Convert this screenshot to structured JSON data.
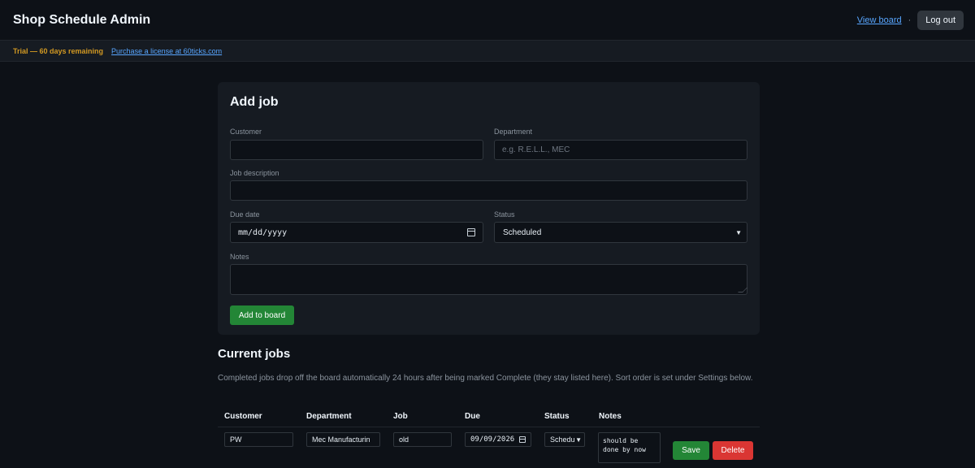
{
  "header": {
    "title": "Shop Schedule Admin",
    "view_board": "View board",
    "separator": "·",
    "logout": "Log out"
  },
  "trial": {
    "text": "Trial — 60 days remaining",
    "link": "Purchase a license at 60ticks.com"
  },
  "add_job": {
    "title": "Add job",
    "customer_label": "Customer",
    "customer_value": "",
    "department_label": "Department",
    "department_placeholder": "e.g. R.E.L.L., MEC",
    "description_label": "Job description",
    "description_value": "",
    "due_label": "Due date",
    "due_placeholder": "mm/dd/yyyy",
    "status_label": "Status",
    "status_value": "Scheduled",
    "notes_label": "Notes",
    "notes_value": "",
    "submit": "Add to board"
  },
  "current_jobs": {
    "title": "Current jobs",
    "description": "Completed jobs drop off the board automatically 24 hours after being marked Complete (they stay listed here). Sort order is set under Settings below.",
    "columns": [
      "Customer",
      "Department",
      "Job",
      "Due",
      "Status",
      "Notes"
    ],
    "rows": [
      {
        "customer": "PW",
        "department": "Mec Manufacturin",
        "job": "old",
        "due": "09/09/2026",
        "status": "Schedu",
        "notes": "should be done by now",
        "save": "Save",
        "delete": "Delete"
      }
    ]
  },
  "colors": {
    "background": "#0d1117",
    "card": "#161b22",
    "accent_link": "#58a6ff",
    "trial_text": "#d29922",
    "save_button": "#238636",
    "delete_button": "#da3633"
  }
}
